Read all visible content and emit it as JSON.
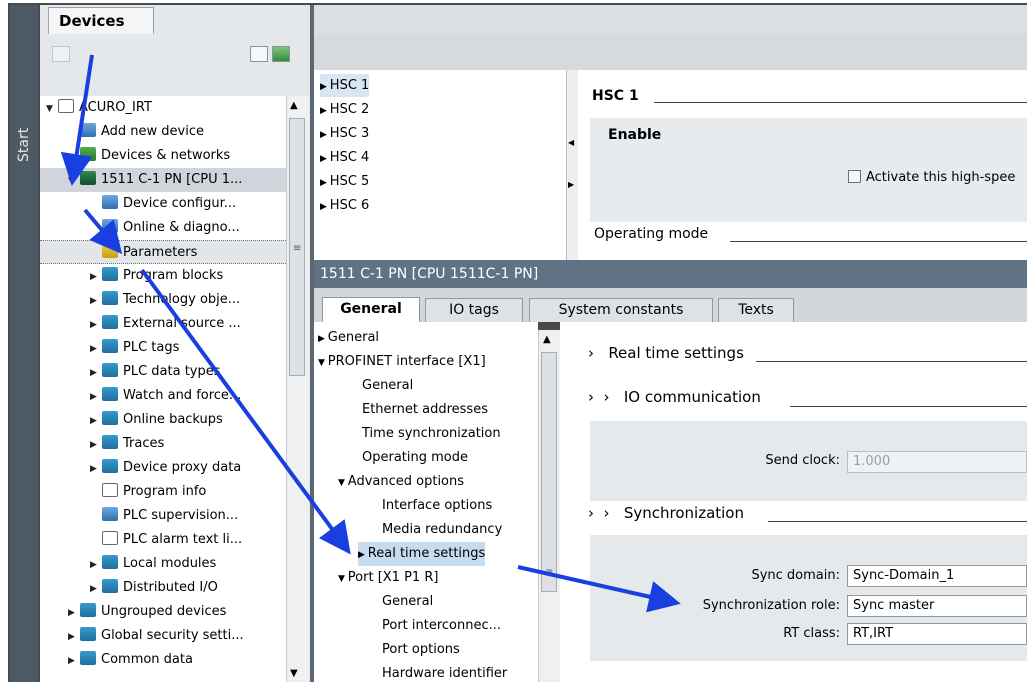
{
  "start_label": "Start",
  "devices_tab": "Devices",
  "tree": [
    {
      "label": "ACURO_IRT",
      "level": 0,
      "expanded": true,
      "icon": "project-icon"
    },
    {
      "label": "Add new device",
      "level": 1,
      "icon": "add-device-icon"
    },
    {
      "label": "Devices & networks",
      "level": 1,
      "icon": "network-icon"
    },
    {
      "label": "1511 C-1 PN [CPU 1...",
      "level": 1,
      "expanded": true,
      "icon": "cpu-icon"
    },
    {
      "label": "Device configur...",
      "level": 2,
      "icon": "device-config-icon"
    },
    {
      "label": "Online & diagno...",
      "level": 2,
      "icon": "diagnostics-icon"
    },
    {
      "label": "Parameters",
      "level": 2,
      "icon": "parameters-icon"
    },
    {
      "label": "Program blocks",
      "level": 2,
      "collapsed": true,
      "icon": "folder-icon"
    },
    {
      "label": "Technology obje...",
      "level": 2,
      "collapsed": true,
      "icon": "folder-icon"
    },
    {
      "label": "External source ...",
      "level": 2,
      "collapsed": true,
      "icon": "folder-icon"
    },
    {
      "label": "PLC tags",
      "level": 2,
      "collapsed": true,
      "icon": "folder-icon"
    },
    {
      "label": "PLC data types",
      "level": 2,
      "collapsed": true,
      "icon": "folder-icon"
    },
    {
      "label": "Watch and force...",
      "level": 2,
      "collapsed": true,
      "icon": "folder-icon"
    },
    {
      "label": "Online backups",
      "level": 2,
      "collapsed": true,
      "icon": "folder-icon"
    },
    {
      "label": "Traces",
      "level": 2,
      "collapsed": true,
      "icon": "folder-icon"
    },
    {
      "label": "Device proxy data",
      "level": 2,
      "collapsed": true,
      "icon": "folder-icon"
    },
    {
      "label": "Program info",
      "level": 2,
      "icon": "program-info-icon"
    },
    {
      "label": "PLC supervision...",
      "level": 2,
      "icon": "supervision-icon"
    },
    {
      "label": "PLC alarm text li...",
      "level": 2,
      "icon": "alarm-text-icon"
    },
    {
      "label": "Local modules",
      "level": 2,
      "collapsed": true,
      "icon": "folder-icon"
    },
    {
      "label": "Distributed I/O",
      "level": 2,
      "collapsed": true,
      "icon": "folder-icon"
    },
    {
      "label": "Ungrouped devices",
      "level": 1,
      "collapsed": true,
      "icon": "folder-icon"
    },
    {
      "label": "Global security setti...",
      "level": 1,
      "collapsed": true,
      "icon": "folder-icon"
    },
    {
      "label": "Common data",
      "level": 1,
      "collapsed": true,
      "icon": "folder-icon"
    }
  ],
  "hsc_list": [
    "HSC 1",
    "HSC 2",
    "HSC 3",
    "HSC 4",
    "HSC 5",
    "HSC 6"
  ],
  "hsc_detail": {
    "title": "HSC 1",
    "enable_title": "Enable",
    "checkbox_label": "Activate this high-spee",
    "operating_mode": "Operating mode"
  },
  "inspector": {
    "title": "1511 C-1 PN [CPU 1511C-1 PN]",
    "tabs": [
      "General",
      "IO tags",
      "System constants",
      "Texts"
    ]
  },
  "nav": [
    {
      "label": "General",
      "level": 0,
      "collapsed": true
    },
    {
      "label": "PROFINET interface [X1]",
      "level": 0,
      "expanded": true
    },
    {
      "label": "General",
      "level": 1
    },
    {
      "label": "Ethernet addresses",
      "level": 1
    },
    {
      "label": "Time synchronization",
      "level": 1
    },
    {
      "label": "Operating mode",
      "level": 1
    },
    {
      "label": "Advanced options",
      "level": 1,
      "expanded": true
    },
    {
      "label": "Interface options",
      "level": 2
    },
    {
      "label": "Media redundancy",
      "level": 2
    },
    {
      "label": "Real time settings",
      "level": 2,
      "collapsed": true,
      "selected": true
    },
    {
      "label": "Port [X1 P1 R]",
      "level": 1,
      "expanded": true
    },
    {
      "label": "General",
      "level": 2
    },
    {
      "label": "Port interconnec...",
      "level": 2
    },
    {
      "label": "Port options",
      "level": 2
    },
    {
      "label": "Hardware identifier",
      "level": 2
    }
  ],
  "content": {
    "rts_title": "Real time settings",
    "io_comm_title": "IO communication",
    "send_clock_label": "Send clock:",
    "send_clock_value": "1.000",
    "sync_title": "Synchronization",
    "sync_domain_label": "Sync domain:",
    "sync_domain_value": "Sync-Domain_1",
    "sync_role_label": "Synchronization role:",
    "sync_role_value": "Sync master",
    "rt_class_label": "RT class:",
    "rt_class_value": "RT,IRT"
  },
  "colors": {
    "arrow": "#1a3fe0",
    "inspector_title": "#5f7385",
    "start_strip": "#4d5a66"
  }
}
